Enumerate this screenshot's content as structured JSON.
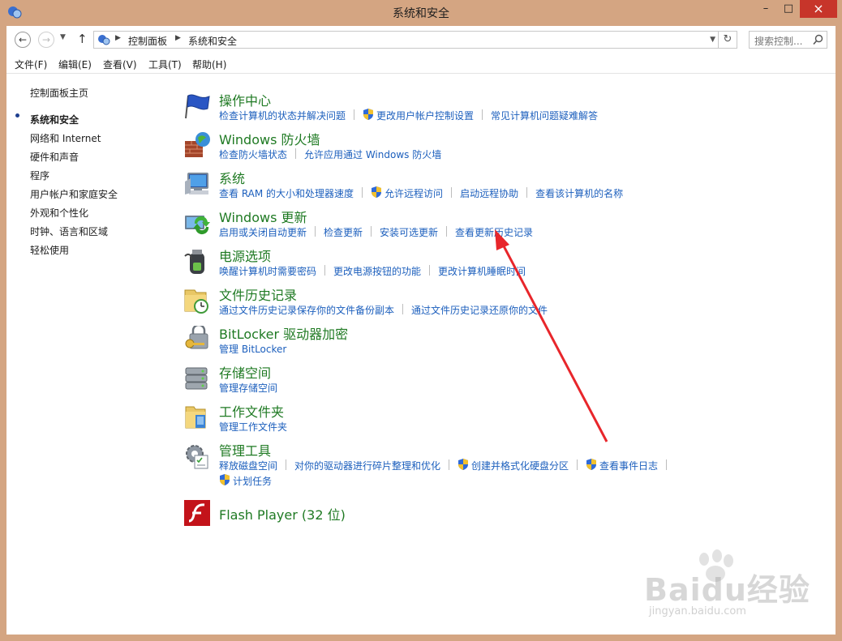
{
  "window": {
    "title": "系统和安全"
  },
  "nav": {
    "breadcrumbs": [
      "控制面板",
      "系统和安全"
    ],
    "search_placeholder": "搜索控制..."
  },
  "menu": [
    "文件(F)",
    "编辑(E)",
    "查看(V)",
    "工具(T)",
    "帮助(H)"
  ],
  "sidebar": {
    "home": "控制面板主页",
    "items": [
      {
        "label": "系统和安全",
        "current": true
      },
      {
        "label": "网络和 Internet"
      },
      {
        "label": "硬件和声音"
      },
      {
        "label": "程序"
      },
      {
        "label": "用户帐户和家庭安全"
      },
      {
        "label": "外观和个性化"
      },
      {
        "label": "时钟、语言和区域"
      },
      {
        "label": "轻松使用"
      }
    ]
  },
  "categories": [
    {
      "icon": "action-center-flag-icon",
      "title": "操作中心",
      "links": [
        "检查计算机的状态并解决问题",
        "更改用户帐户控制设置",
        "常见计算机问题疑难解答"
      ]
    },
    {
      "icon": "firewall-icon",
      "title": "Windows 防火墙",
      "links": [
        "检查防火墙状态",
        "允许应用通过 Windows 防火墙"
      ]
    },
    {
      "icon": "system-computer-icon",
      "title": "系统",
      "links": [
        "查看 RAM 的大小和处理器速度",
        "允许远程访问",
        "启动远程协助",
        "查看该计算机的名称"
      ]
    },
    {
      "icon": "windows-update-icon",
      "title": "Windows 更新",
      "links": [
        "启用或关闭自动更新",
        "检查更新",
        "安装可选更新",
        "查看更新历史记录"
      ]
    },
    {
      "icon": "power-options-icon",
      "title": "电源选项",
      "links": [
        "唤醒计算机时需要密码",
        "更改电源按钮的功能",
        "更改计算机睡眠时间"
      ]
    },
    {
      "icon": "file-history-icon",
      "title": "文件历史记录",
      "links": [
        "通过文件历史记录保存你的文件备份副本",
        "通过文件历史记录还原你的文件"
      ]
    },
    {
      "icon": "bitlocker-key-icon",
      "title": "BitLocker 驱动器加密",
      "links": [
        "管理 BitLocker"
      ]
    },
    {
      "icon": "storage-spaces-icon",
      "title": "存储空间",
      "links": [
        "管理存储空间"
      ]
    },
    {
      "icon": "work-folders-icon",
      "title": "工作文件夹",
      "links": [
        "管理工作文件夹"
      ]
    },
    {
      "icon": "admin-tools-icon",
      "title": "管理工具",
      "links": [
        "释放磁盘空间",
        "对你的驱动器进行碎片整理和优化",
        "创建并格式化硬盘分区",
        "查看事件日志",
        "计划任务"
      ]
    },
    {
      "icon": "flash-player-icon",
      "title": "Flash Player (32 位)",
      "links": []
    }
  ],
  "watermark": {
    "brand": "Baidu经验",
    "url": "jingyan.baidu.com"
  },
  "colors": {
    "frame": "#d4a582",
    "title_green": "#1f7a23",
    "link_blue": "#1c5fbd",
    "close_red": "#c7352a",
    "arrow_red": "#e8262b"
  }
}
